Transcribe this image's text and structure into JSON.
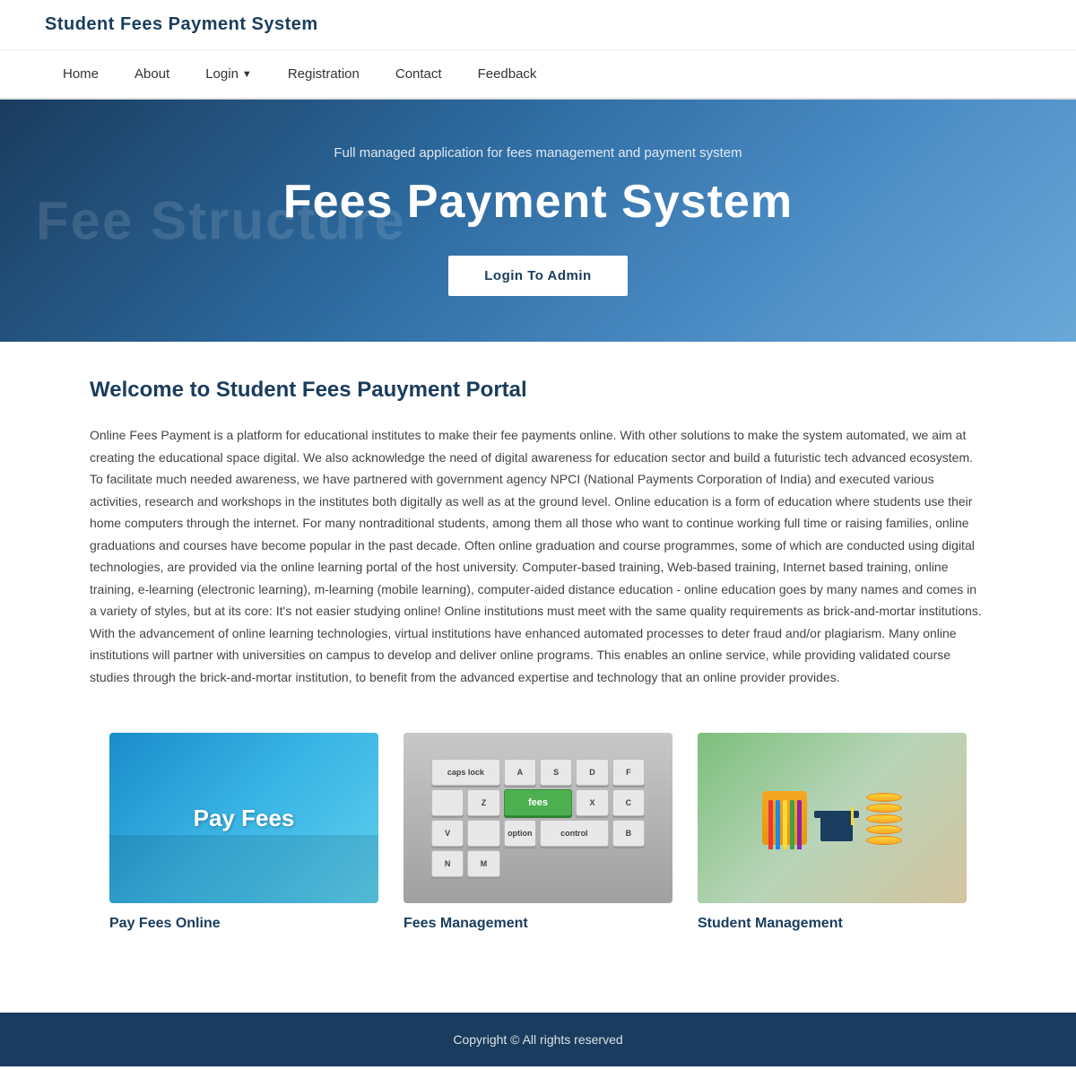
{
  "header": {
    "logo": "Student Fees Payment System"
  },
  "nav": {
    "items": [
      {
        "label": "Home",
        "href": "#"
      },
      {
        "label": "About",
        "href": "#"
      },
      {
        "label": "Login",
        "href": "#",
        "hasDropdown": true
      },
      {
        "label": "Registration",
        "href": "#"
      },
      {
        "label": "Contact",
        "href": "#"
      },
      {
        "label": "Feedback",
        "href": "#"
      }
    ]
  },
  "hero": {
    "bg_text": "Fee Structure",
    "subtitle": "Full managed application for fees management and payment system",
    "title": "Fees Payment System",
    "btn_label": "Login To Admin"
  },
  "main": {
    "welcome_title": "Welcome to Student Fees Pauyment Portal",
    "welcome_text": "Online Fees Payment is a platform for educational institutes to make their fee payments online. With other solutions to make the system automated, we aim at creating the educational space digital. We also acknowledge the need of digital awareness for education sector and build a futuristic tech advanced ecosystem. To facilitate much needed awareness, we have partnered with government agency NPCI (National Payments Corporation of India) and executed various activities, research and workshops in the institutes both digitally as well as at the ground level. Online education is a form of education where students use their home computers through the internet. For many nontraditional students, among them all those who want to continue working full time or raising families, online graduations and courses have become popular in the past decade. Often online graduation and course programmes, some of which are conducted using digital technologies, are provided via the online learning portal of the host university. Computer-based training, Web-based training, Internet based training, online training, e-learning (electronic learning), m-learning (mobile learning), computer-aided distance education - online education goes by many names and comes in a variety of styles, but at its core: It's not easier studying online! Online institutions must meet with the same quality requirements as brick-and-mortar institutions. With the advancement of online learning technologies, virtual institutions have enhanced automated processes to deter fraud and/or plagiarism. Many online institutions will partner with universities on campus to develop and deliver online programs. This enables an online service, while providing validated course studies through the brick-and-mortar institution, to benefit from the advanced expertise and technology that an online provider provides."
  },
  "cards": [
    {
      "id": "pay-fees",
      "image_label": "Pay Fees",
      "title": "Pay Fees Online"
    },
    {
      "id": "fees-mgmt",
      "image_label": "fees",
      "title": "Fees Management"
    },
    {
      "id": "student-mgmt",
      "image_label": "",
      "title": "Student Management"
    }
  ],
  "footer": {
    "copyright": "Copyright © All rights reserved"
  }
}
